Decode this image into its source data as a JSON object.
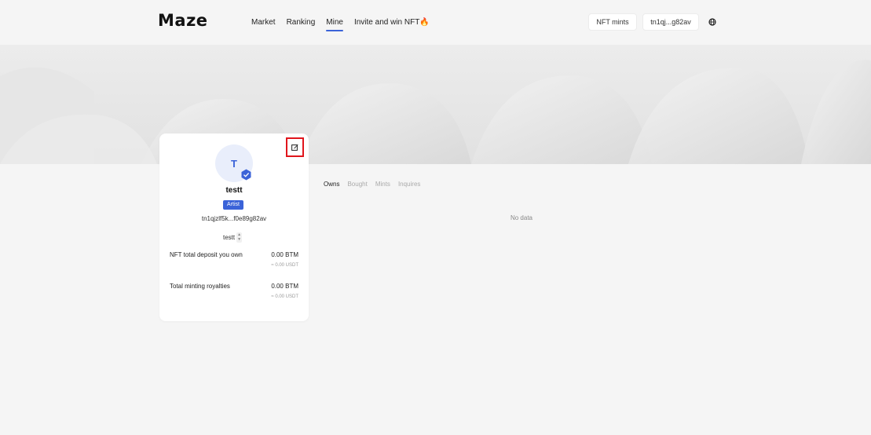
{
  "header": {
    "logo": "Maze",
    "nav": [
      "Market",
      "Ranking",
      "Mine",
      "Invite and win NFT"
    ],
    "active_nav": "Mine",
    "nft_mints_button": "NFT mints",
    "wallet_button": "tn1qj...g82av"
  },
  "profile": {
    "avatar_letter": "T",
    "username": "testt",
    "role_badge": "Artist",
    "address": "tn1qjzlf5k...f0e89g82av",
    "selector_value": "testt",
    "stats": [
      {
        "label": "NFT total deposit you own",
        "value": "0.00 BTM",
        "sub": "≈ 0.00 USDT"
      },
      {
        "label": "Total minting royalties",
        "value": "0.00 BTM",
        "sub": "≈ 0.00 USDT"
      }
    ]
  },
  "tabs": [
    "Owns",
    "Bought",
    "Mints",
    "Inquires"
  ],
  "active_tab": "Owns",
  "empty_text": "No data",
  "colors": {
    "accent": "#3b63d8",
    "highlight": "#e0151c",
    "background": "#f5f5f5"
  }
}
